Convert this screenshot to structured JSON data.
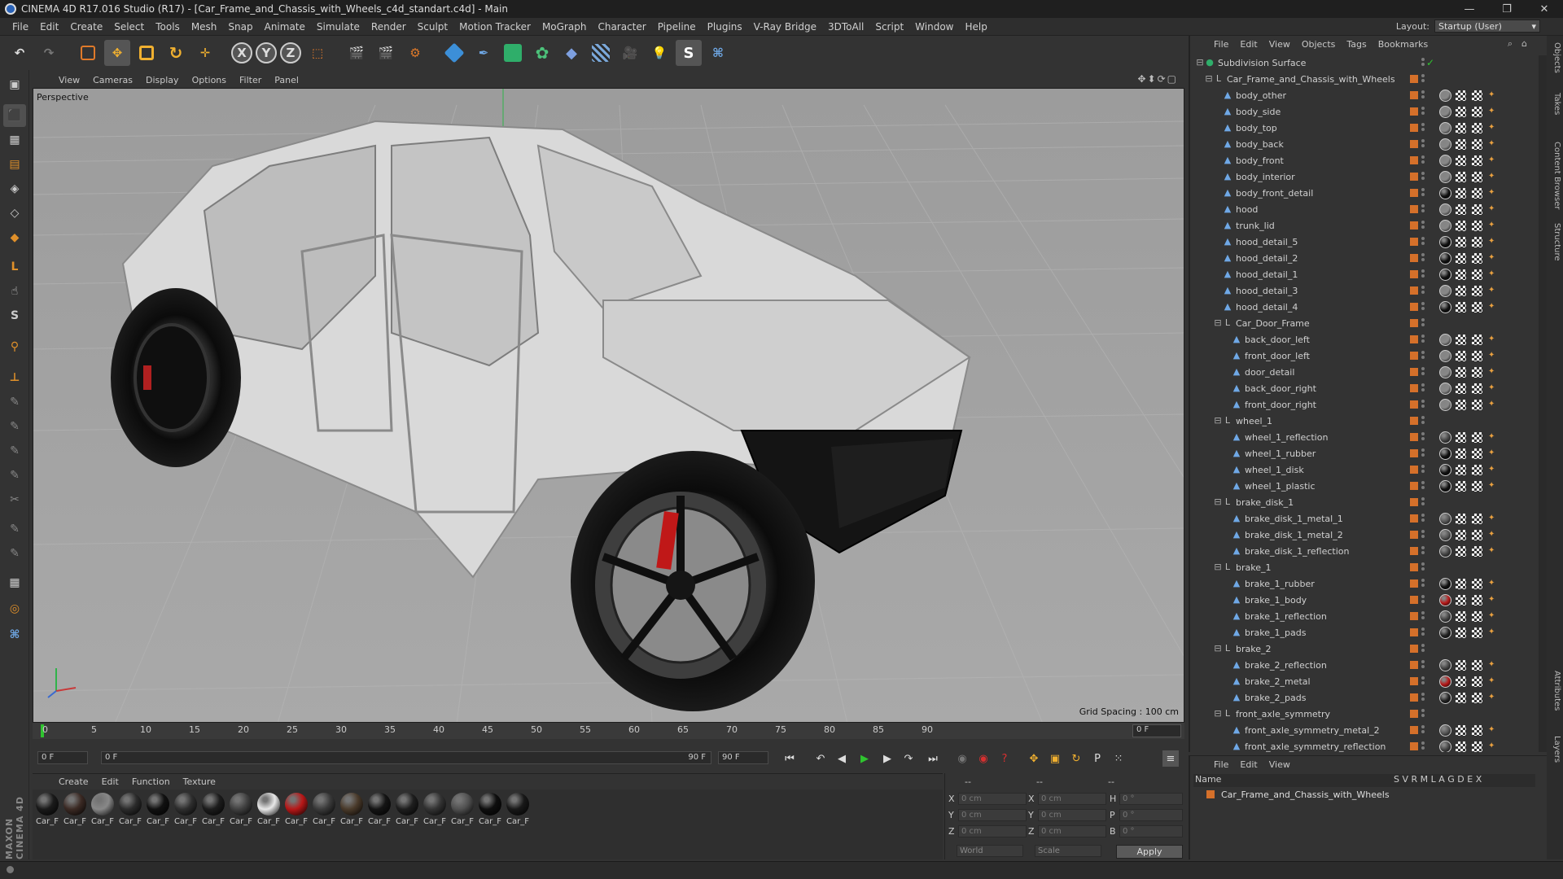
{
  "titlebar": {
    "title": "CINEMA 4D R17.016 Studio (R17) - [Car_Frame_and_Chassis_with_Wheels_c4d_standart.c4d] - Main",
    "min": "—",
    "max": "❐",
    "close": "✕"
  },
  "menubar": [
    "File",
    "Edit",
    "Create",
    "Select",
    "Tools",
    "Mesh",
    "Snap",
    "Animate",
    "Simulate",
    "Render",
    "Sculpt",
    "Motion Tracker",
    "MoGraph",
    "Character",
    "Pipeline",
    "Plugins",
    "V-Ray Bridge",
    "3DToAll",
    "Script",
    "Window",
    "Help"
  ],
  "layout": {
    "label": "Layout:",
    "value": "Startup (User)"
  },
  "viewport": {
    "menu": [
      "View",
      "Cameras",
      "Display",
      "Options",
      "Filter",
      "Panel"
    ],
    "camera": "Perspective",
    "grid_spacing": "Grid Spacing : 100 cm"
  },
  "timeline": {
    "ticks": [
      "0",
      "5",
      "10",
      "15",
      "20",
      "25",
      "30",
      "35",
      "40",
      "45",
      "50",
      "55",
      "60",
      "65",
      "70",
      "75",
      "80",
      "85",
      "90"
    ],
    "current": "0 F"
  },
  "playbar": {
    "start": "0 F",
    "slider_start": "0 F",
    "slider_end": "90 F",
    "end": "90 F"
  },
  "materials": {
    "menu": [
      "Create",
      "Edit",
      "Function",
      "Texture"
    ],
    "items": [
      {
        "label": "Car_F",
        "color": "#1a1a1a"
      },
      {
        "label": "Car_F",
        "color": "#3b2a24"
      },
      {
        "label": "Car_F",
        "color": "#888888"
      },
      {
        "label": "Car_F",
        "color": "#2b2b2b"
      },
      {
        "label": "Car_F",
        "color": "#111111"
      },
      {
        "label": "Car_F",
        "color": "#2e2e2e"
      },
      {
        "label": "Car_F",
        "color": "#1c1c1c"
      },
      {
        "label": "Car_F",
        "color": "#404040"
      },
      {
        "label": "Car_F",
        "color": "#e8e8e8"
      },
      {
        "label": "Car_F",
        "color": "#b81818"
      },
      {
        "label": "Car_F",
        "color": "#3a3a3a"
      },
      {
        "label": "Car_F",
        "color": "#4a3a2a"
      },
      {
        "label": "Car_F",
        "color": "#141414"
      },
      {
        "label": "Car_F",
        "color": "#1e1e1e"
      },
      {
        "label": "Car_F",
        "color": "#333333"
      },
      {
        "label": "Car_F",
        "color": "#505050"
      },
      {
        "label": "Car_F",
        "color": "#0e0e0e"
      },
      {
        "label": "Car_F",
        "color": "#181818"
      }
    ]
  },
  "coords": {
    "hdr1": "--",
    "hdr2": "--",
    "hdr3": "--",
    "rows": [
      {
        "a": "X",
        "av": "0 cm",
        "b": "X",
        "bv": "0 cm",
        "c": "H",
        "cv": "0 °"
      },
      {
        "a": "Y",
        "av": "0 cm",
        "b": "Y",
        "bv": "0 cm",
        "c": "P",
        "cv": "0 °"
      },
      {
        "a": "Z",
        "av": "0 cm",
        "b": "Z",
        "bv": "0 cm",
        "c": "B",
        "cv": "0 °"
      }
    ],
    "world": "World",
    "scale": "Scale",
    "apply": "Apply"
  },
  "objects": {
    "menu": [
      "File",
      "Edit",
      "View",
      "Objects",
      "Tags",
      "Bookmarks"
    ],
    "items": [
      {
        "name": "Subdivision Surface",
        "indent": 0,
        "kind": "root",
        "mat": ""
      },
      {
        "name": "Car_Frame_and_Chassis_with_Wheels",
        "indent": 1,
        "kind": "null",
        "mat": ""
      },
      {
        "name": "body_other",
        "indent": 2,
        "kind": "obj",
        "mat": "#888888"
      },
      {
        "name": "body_side",
        "indent": 2,
        "kind": "obj",
        "mat": "#888888"
      },
      {
        "name": "body_top",
        "indent": 2,
        "kind": "obj",
        "mat": "#888888"
      },
      {
        "name": "body_back",
        "indent": 2,
        "kind": "obj",
        "mat": "#888888"
      },
      {
        "name": "body_front",
        "indent": 2,
        "kind": "obj",
        "mat": "#888888"
      },
      {
        "name": "body_interior",
        "indent": 2,
        "kind": "obj",
        "mat": "#888888"
      },
      {
        "name": "body_front_detail",
        "indent": 2,
        "kind": "obj",
        "mat": "#111111"
      },
      {
        "name": "hood",
        "indent": 2,
        "kind": "obj",
        "mat": "#888888"
      },
      {
        "name": "trunk_lid",
        "indent": 2,
        "kind": "obj",
        "mat": "#888888"
      },
      {
        "name": "hood_detail_5",
        "indent": 2,
        "kind": "obj",
        "mat": "#111111"
      },
      {
        "name": "hood_detail_2",
        "indent": 2,
        "kind": "obj",
        "mat": "#111111"
      },
      {
        "name": "hood_detail_1",
        "indent": 2,
        "kind": "obj",
        "mat": "#111111"
      },
      {
        "name": "hood_detail_3",
        "indent": 2,
        "kind": "obj",
        "mat": "#888888"
      },
      {
        "name": "hood_detail_4",
        "indent": 2,
        "kind": "obj",
        "mat": "#111111"
      },
      {
        "name": "Car_Door_Frame",
        "indent": 2,
        "kind": "null",
        "mat": ""
      },
      {
        "name": "back_door_left",
        "indent": 3,
        "kind": "obj",
        "mat": "#888888"
      },
      {
        "name": "front_door_left",
        "indent": 3,
        "kind": "obj",
        "mat": "#888888"
      },
      {
        "name": "door_detail",
        "indent": 3,
        "kind": "obj",
        "mat": "#888888"
      },
      {
        "name": "back_door_right",
        "indent": 3,
        "kind": "obj",
        "mat": "#888888"
      },
      {
        "name": "front_door_right",
        "indent": 3,
        "kind": "obj",
        "mat": "#888888"
      },
      {
        "name": "wheel_1",
        "indent": 2,
        "kind": "null",
        "mat": ""
      },
      {
        "name": "wheel_1_reflection",
        "indent": 3,
        "kind": "obj",
        "mat": "#444444"
      },
      {
        "name": "wheel_1_rubber",
        "indent": 3,
        "kind": "obj",
        "mat": "#111111"
      },
      {
        "name": "wheel_1_disk",
        "indent": 3,
        "kind": "obj",
        "mat": "#111111"
      },
      {
        "name": "wheel_1_plastic",
        "indent": 3,
        "kind": "obj",
        "mat": "#111111"
      },
      {
        "name": "brake_disk_1",
        "indent": 2,
        "kind": "null",
        "mat": ""
      },
      {
        "name": "brake_disk_1_metal_1",
        "indent": 3,
        "kind": "obj",
        "mat": "#555555"
      },
      {
        "name": "brake_disk_1_metal_2",
        "indent": 3,
        "kind": "obj",
        "mat": "#555555"
      },
      {
        "name": "brake_disk_1_reflection",
        "indent": 3,
        "kind": "obj",
        "mat": "#444444"
      },
      {
        "name": "brake_1",
        "indent": 2,
        "kind": "null",
        "mat": ""
      },
      {
        "name": "brake_1_rubber",
        "indent": 3,
        "kind": "obj",
        "mat": "#111111"
      },
      {
        "name": "brake_1_body",
        "indent": 3,
        "kind": "obj",
        "mat": "#b81818"
      },
      {
        "name": "brake_1_reflection",
        "indent": 3,
        "kind": "obj",
        "mat": "#444444"
      },
      {
        "name": "brake_1_pads",
        "indent": 3,
        "kind": "obj",
        "mat": "#222222"
      },
      {
        "name": "brake_2",
        "indent": 2,
        "kind": "null",
        "mat": ""
      },
      {
        "name": "brake_2_reflection",
        "indent": 3,
        "kind": "obj",
        "mat": "#444444"
      },
      {
        "name": "brake_2_metal",
        "indent": 3,
        "kind": "obj",
        "mat": "#b81818"
      },
      {
        "name": "brake_2_pads",
        "indent": 3,
        "kind": "obj",
        "mat": "#222222"
      },
      {
        "name": "front_axle_symmetry",
        "indent": 2,
        "kind": "null",
        "mat": ""
      },
      {
        "name": "front_axle_symmetry_metal_2",
        "indent": 3,
        "kind": "obj",
        "mat": "#555555"
      },
      {
        "name": "front_axle_symmetry_reflection",
        "indent": 3,
        "kind": "obj",
        "mat": "#444444"
      }
    ]
  },
  "layers": {
    "menu": [
      "File",
      "Edit",
      "View"
    ],
    "header": "Name",
    "cols": "S  V  R  M  L  A  G  D  E  X",
    "row": "Car_Frame_and_Chassis_with_Wheels"
  },
  "righttabs": [
    "Objects",
    "Takes",
    "Content Browser",
    "Structure",
    "Attributes",
    "Layers"
  ],
  "brand": "MAXON CINEMA 4D"
}
